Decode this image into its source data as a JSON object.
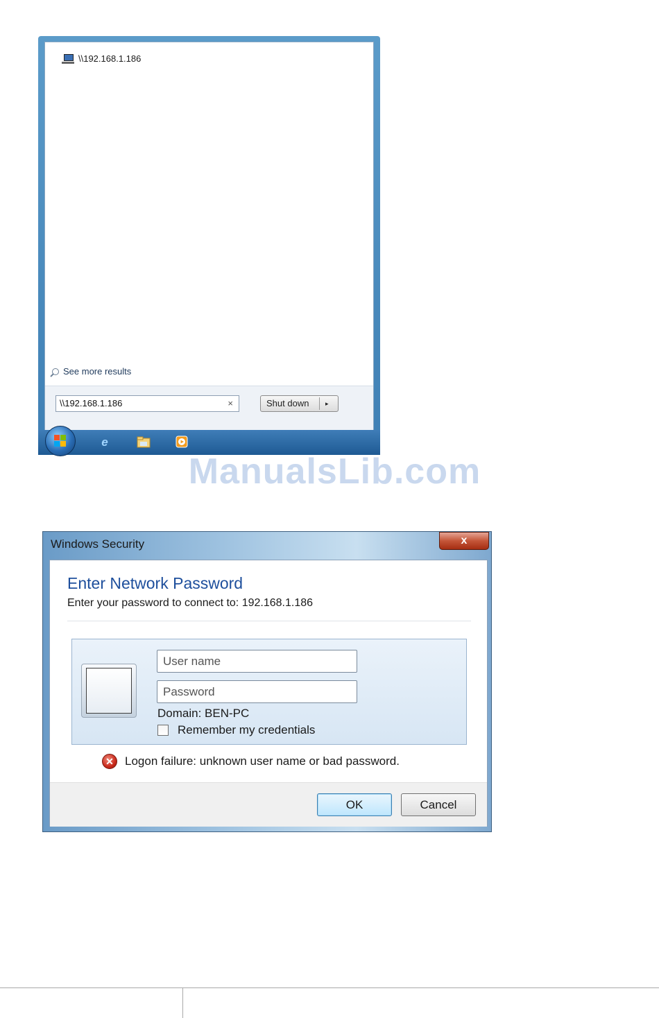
{
  "start_menu": {
    "result_item": "\\\\192.168.1.186",
    "see_more": "See more results",
    "search_value": "\\\\192.168.1.186",
    "clear_glyph": "×",
    "shutdown_label": "Shut down",
    "shutdown_arrow": "▸",
    "taskbar_icons": [
      "windows-start-orb",
      "internet-explorer-icon",
      "windows-explorer-icon",
      "media-player-icon"
    ]
  },
  "watermark": "ManualsLib.com",
  "dialog": {
    "title": "Windows Security",
    "close_glyph": "x",
    "heading": "Enter Network Password",
    "subheading": "Enter your password to connect to: 192.168.1.186",
    "username_placeholder": "User name",
    "password_placeholder": "Password",
    "domain": "Domain: BEN-PC",
    "remember_label": "Remember my credentials",
    "error_glyph": "✕",
    "error_message": "Logon failure: unknown user name or bad password.",
    "ok_label": "OK",
    "cancel_label": "Cancel"
  },
  "colors": {
    "heading_blue": "#1e4f9c",
    "taskbar_blue": "#2a6aa6",
    "watermark": "#c9d8ee"
  }
}
